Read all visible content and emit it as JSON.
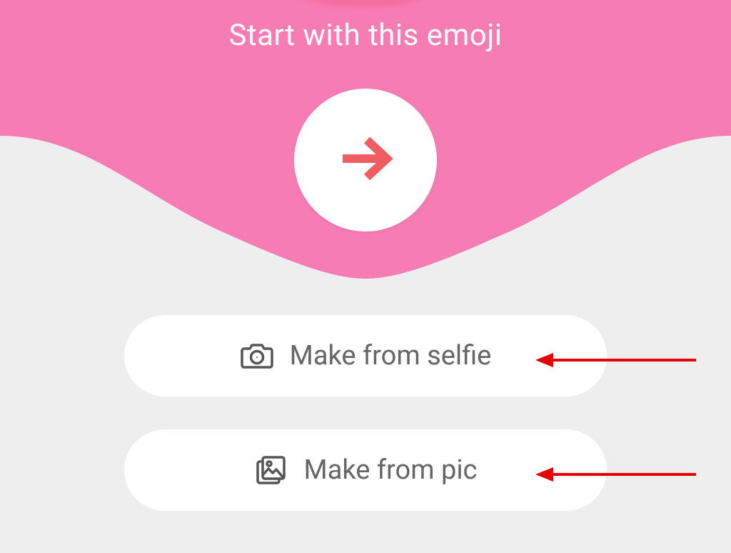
{
  "colors": {
    "hero_pink": "#f77cb4",
    "accent": "#ef5d61",
    "pill_text": "#666666",
    "annotation": "#e60000"
  },
  "hero": {
    "title": "Start with this emoji",
    "icon": "arrow-right"
  },
  "options": [
    {
      "icon": "camera",
      "label": "Make from selfie"
    },
    {
      "icon": "image",
      "label": "Make from pic"
    }
  ]
}
